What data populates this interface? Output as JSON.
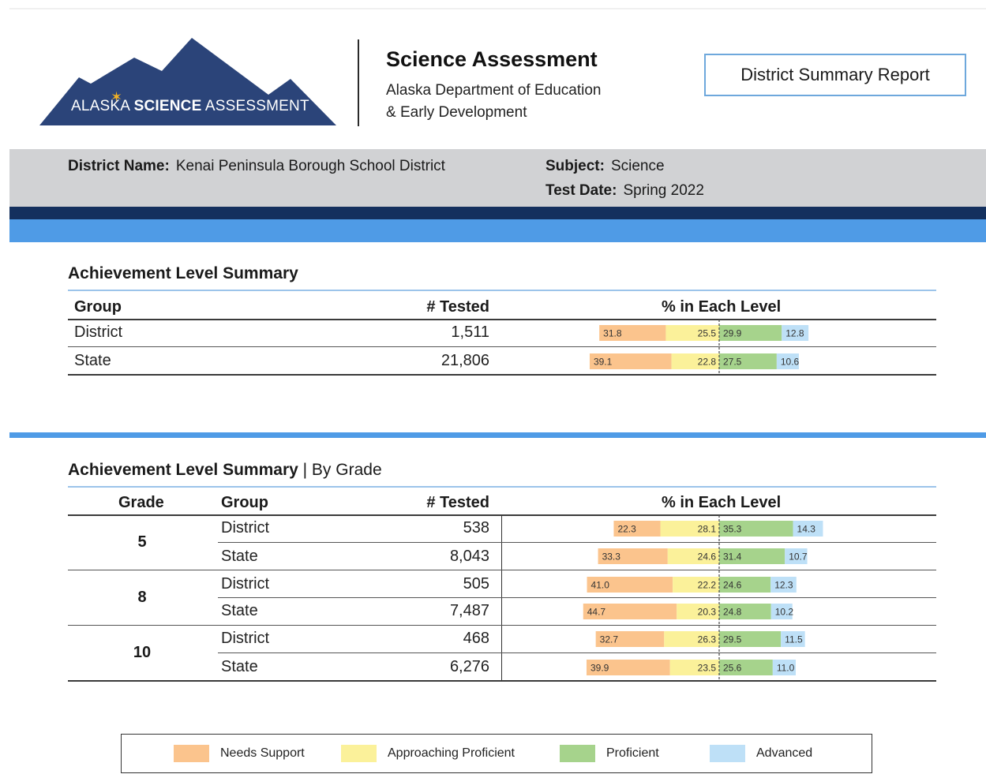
{
  "header": {
    "logo_text_light": "ALASKA",
    "logo_text_bold": "SCIENCE",
    "logo_text_end": "ASSESSMENT",
    "title": "Science Assessment",
    "subtitle_line1": "Alaska Department of Education",
    "subtitle_line2": "& Early Development",
    "report_type": "District Summary Report",
    "colors": {
      "logo": "#2b4479",
      "star": "#f5b324"
    }
  },
  "info": {
    "district_label": "District Name:",
    "district_value": "Kenai Peninsula Borough School District",
    "subject_label": "Subject:",
    "subject_value": "Science",
    "date_label": "Test Date:",
    "date_value": "Spring 2022"
  },
  "summary": {
    "title": "Achievement Level Summary",
    "col_group": "Group",
    "col_tested": "# Tested",
    "col_levels": "% in Each Level",
    "rows": [
      {
        "group": "District",
        "tested": "1,511"
      },
      {
        "group": "State",
        "tested": "21,806"
      }
    ]
  },
  "by_grade": {
    "title": "Achievement Level Summary",
    "title_suffix": "| By Grade",
    "col_grade": "Grade",
    "col_group": "Group",
    "col_tested": "# Tested",
    "col_levels": "% in Each Level",
    "grades": [
      {
        "grade": "5",
        "rows": [
          {
            "group": "District",
            "tested": "538"
          },
          {
            "group": "State",
            "tested": "8,043"
          }
        ]
      },
      {
        "grade": "8",
        "rows": [
          {
            "group": "District",
            "tested": "505"
          },
          {
            "group": "State",
            "tested": "7,487"
          }
        ]
      },
      {
        "grade": "10",
        "rows": [
          {
            "group": "District",
            "tested": "468"
          },
          {
            "group": "State",
            "tested": "6,276"
          }
        ]
      }
    ]
  },
  "legend": {
    "needs_support": "Needs Support",
    "approaching": "Approaching Proficient",
    "proficient": "Proficient",
    "advanced": "Advanced"
  },
  "colors": {
    "needs_support": "#fbc48d",
    "approaching": "#fbf19a",
    "proficient": "#a6d38c",
    "advanced": "#bee0f7"
  },
  "chart_data": {
    "type": "bar",
    "stacked": true,
    "diverging_at": "proficient",
    "series_names": [
      "Needs Support",
      "Approaching Proficient",
      "Proficient",
      "Advanced"
    ],
    "rows": [
      {
        "label": "District",
        "values": [
          31.8,
          25.5,
          29.9,
          12.8
        ]
      },
      {
        "label": "State",
        "values": [
          39.1,
          22.8,
          27.5,
          10.6
        ]
      },
      {
        "label": "Grade 5 District",
        "values": [
          22.3,
          28.1,
          35.3,
          14.3
        ]
      },
      {
        "label": "Grade 5 State",
        "values": [
          33.3,
          24.6,
          31.4,
          10.7
        ]
      },
      {
        "label": "Grade 8 District",
        "values": [
          41.0,
          22.2,
          24.6,
          12.3
        ]
      },
      {
        "label": "Grade 8 State",
        "values": [
          44.7,
          20.3,
          24.8,
          10.2
        ]
      },
      {
        "label": "Grade 10 District",
        "values": [
          32.7,
          26.3,
          29.5,
          11.5
        ]
      },
      {
        "label": "Grade 10 State",
        "values": [
          39.9,
          23.5,
          25.6,
          11.0
        ]
      }
    ]
  }
}
